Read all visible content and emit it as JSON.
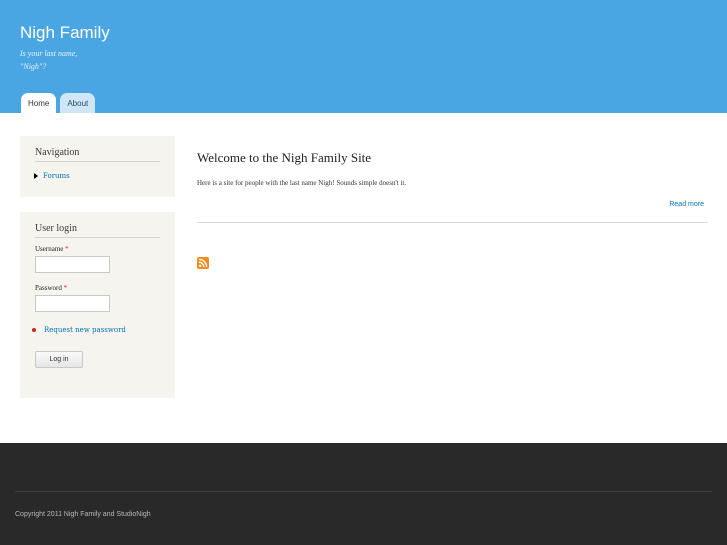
{
  "header": {
    "site_name": "Nigh Family",
    "slogan_line1": "Is your last name,",
    "slogan_line2": "\"Nigh\"?",
    "tabs": [
      {
        "label": "Home"
      },
      {
        "label": "About"
      }
    ]
  },
  "sidebar": {
    "navigation": {
      "title": "Navigation",
      "items": [
        {
          "label": "Forums"
        }
      ]
    },
    "login": {
      "title": "User login",
      "username_label": "Username",
      "password_label": "Password",
      "required_mark": "*",
      "request_password_link": "Request new password",
      "login_button": "Log in"
    }
  },
  "main": {
    "node_title": "Welcome to the Nigh Family Site",
    "node_body": "Here is a site for people with the last name Nigh! Sounds simple doesn't it.",
    "read_more": "Read more"
  },
  "footer": {
    "copyright": "Copyright 2011 Nigh Family and StudioNigh"
  },
  "colors": {
    "header_bg": "#4aa6e3",
    "link": "#0071b3",
    "footer_bg": "#292929",
    "rss": "#f48c1f"
  },
  "icons": [
    "rss-feed-icon",
    "triangle-bullet-icon",
    "red-bullet-icon"
  ]
}
